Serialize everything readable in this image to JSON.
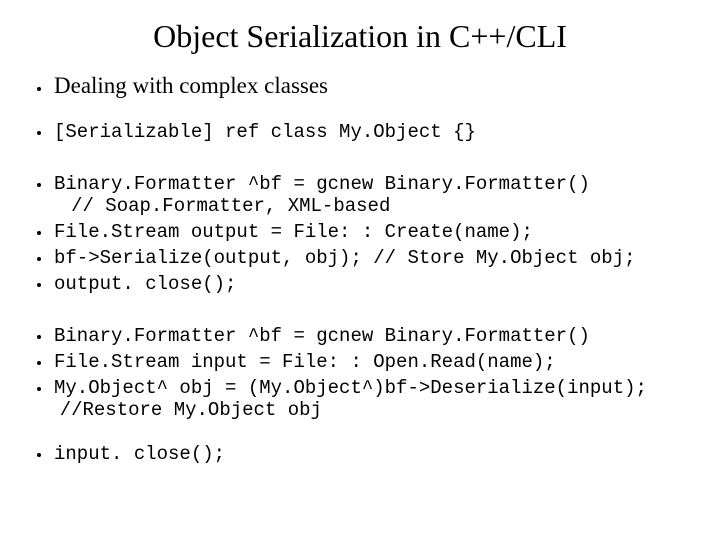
{
  "title": "Object Serialization in C++/CLI",
  "subhead": "Dealing with complex classes",
  "block1": {
    "l1": "[Serializable] ref class My.Object {}"
  },
  "block2": {
    "l1": "Binary.Formatter ^bf = gcnew Binary.Formatter()",
    "l1b": " // Soap.Formatter, XML-based",
    "l2": "File.Stream output = File: : Create(name);",
    "l3": "bf->Serialize(output, obj); // Store My.Object obj;",
    "l4": "output. close();"
  },
  "block3": {
    "l1": "Binary.Formatter ^bf = gcnew Binary.Formatter()",
    "l2": "File.Stream input = File: : Open.Read(name);",
    "l3": "My.Object^ obj = (My.Object^)bf->Deserialize(input);",
    "l3b": "//Restore My.Object obj"
  },
  "block4": {
    "l1": "input. close();"
  }
}
